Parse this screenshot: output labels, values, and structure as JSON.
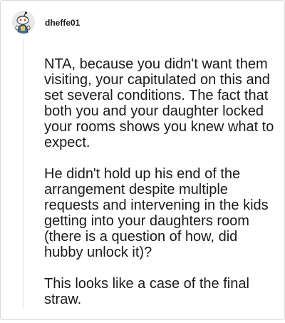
{
  "comment": {
    "author": "dheffe01",
    "avatar_icon": "snoo-avatar-icon",
    "paragraphs": [
      "NTA, because you didn't want them visiting, your capitulated on this and set several conditions. The fact that both you and your daughter locked your rooms shows you knew what to expect.",
      "He didn't hold up his end of the arrangement despite multiple requests and intervening in the kids getting into your daughters room (there is a question of how, did hubby unlock it)?",
      "This looks like a case of the final straw."
    ]
  },
  "colors": {
    "text": "#1a1a1b",
    "border": "#d9d9d9",
    "thread_line": "#e4e4e4"
  }
}
